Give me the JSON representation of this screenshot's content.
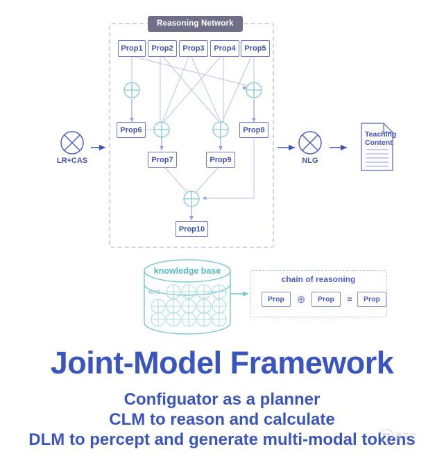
{
  "colors": {
    "prop_border": "#6878d4",
    "prop_text": "#3f51b5",
    "badge_bg": "#6f7087",
    "badge_text": "#ffffff",
    "dashed_panel": "#cfd2ef",
    "link_line": "#b9c2ee",
    "op_circle": "#7fc9d4",
    "kb_teal": "#57bac6",
    "title_blue": "#3b55bf",
    "arrow_blue": "#3f51b5"
  },
  "reasoning_network": {
    "badge_label": "Reasoning Network",
    "top_props": [
      {
        "label": "Prop1"
      },
      {
        "label": "Prop2"
      },
      {
        "label": "Prop3"
      },
      {
        "label": "Prop4"
      },
      {
        "label": "Prop5"
      }
    ],
    "mid_props": [
      {
        "label": "Prop6"
      },
      {
        "label": "Prop8"
      }
    ],
    "lower_props": [
      {
        "label": "Prop7"
      },
      {
        "label": "Prop9"
      }
    ],
    "final_prop": {
      "label": "Prop10"
    },
    "operator_glyph": "plus-circle"
  },
  "pipeline": {
    "input_node": {
      "label": "LR+CAS",
      "icon": "circle-x-icon"
    },
    "output_node": {
      "label": "NLG",
      "icon": "circle-x-icon"
    },
    "document": {
      "line1": "Teaching",
      "line2": "Content",
      "icon": "document-icon",
      "text_lines": 5
    }
  },
  "knowledge_base": {
    "title": "knowledge base",
    "lore_label": "lore",
    "icon": "database-cylinder-icon",
    "grid_rows": 3,
    "grid_cols": 4
  },
  "chain_of_reasoning": {
    "title": "chain of reasoning",
    "terms": [
      {
        "label": "Prop"
      },
      {
        "label": "Prop"
      },
      {
        "label": "Prop"
      }
    ],
    "operator": "⊕",
    "equals": "="
  },
  "headings": {
    "title": "Joint-Model Framework",
    "subtitle_1": "Configuator as a planner",
    "subtitle_2": "CLM to reason and calculate",
    "subtitle_3": "DLM to percept and generate multi-modal tokens"
  },
  "watermark": {
    "text": "量子位"
  }
}
